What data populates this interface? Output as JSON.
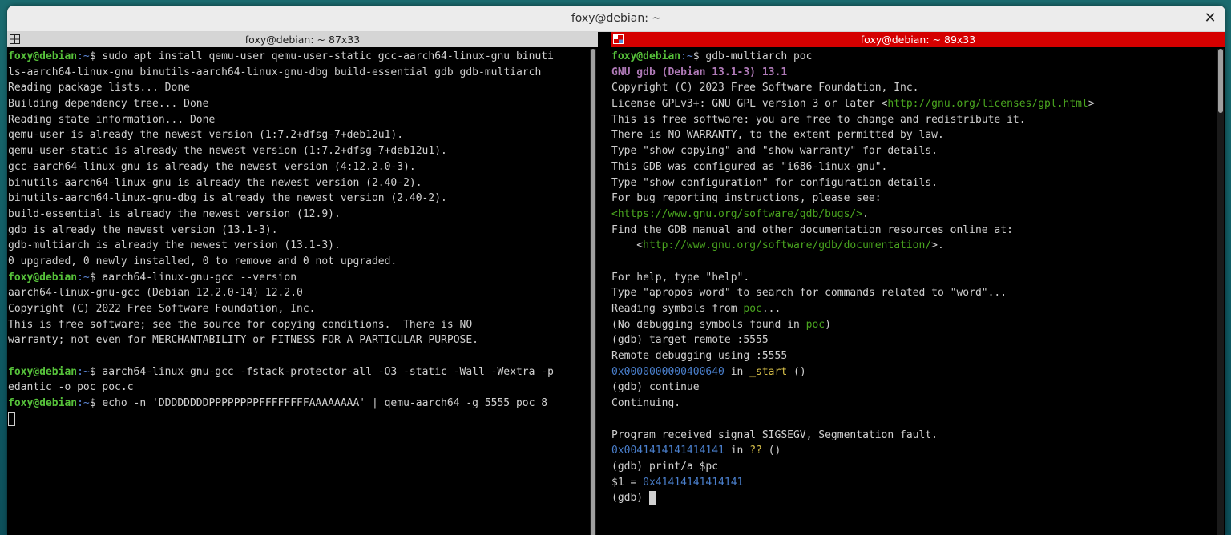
{
  "window": {
    "title": "foxy@debian: ~"
  },
  "left_pane": {
    "title": "foxy@debian: ~ 87x33",
    "lines": [
      [
        {
          "c": "prompt-user",
          "t": "foxy@debian"
        },
        {
          "c": "prompt-path",
          "t": ":~"
        },
        {
          "t": "$ sudo apt install qemu-user qemu-user-static gcc-aarch64-linux-gnu binuti"
        }
      ],
      [
        {
          "t": "ls-aarch64-linux-gnu binutils-aarch64-linux-gnu-dbg build-essential gdb gdb-multiarch"
        }
      ],
      [
        {
          "t": "Reading package lists... Done"
        }
      ],
      [
        {
          "t": "Building dependency tree... Done"
        }
      ],
      [
        {
          "t": "Reading state information... Done"
        }
      ],
      [
        {
          "t": "qemu-user is already the newest version (1:7.2+dfsg-7+deb12u1)."
        }
      ],
      [
        {
          "t": "qemu-user-static is already the newest version (1:7.2+dfsg-7+deb12u1)."
        }
      ],
      [
        {
          "t": "gcc-aarch64-linux-gnu is already the newest version (4:12.2.0-3)."
        }
      ],
      [
        {
          "t": "binutils-aarch64-linux-gnu is already the newest version (2.40-2)."
        }
      ],
      [
        {
          "t": "binutils-aarch64-linux-gnu-dbg is already the newest version (2.40-2)."
        }
      ],
      [
        {
          "t": "build-essential is already the newest version (12.9)."
        }
      ],
      [
        {
          "t": "gdb is already the newest version (13.1-3)."
        }
      ],
      [
        {
          "t": "gdb-multiarch is already the newest version (13.1-3)."
        }
      ],
      [
        {
          "t": "0 upgraded, 0 newly installed, 0 to remove and 0 not upgraded."
        }
      ],
      [
        {
          "c": "prompt-user",
          "t": "foxy@debian"
        },
        {
          "c": "prompt-path",
          "t": ":~"
        },
        {
          "t": "$ aarch64-linux-gnu-gcc --version"
        }
      ],
      [
        {
          "t": "aarch64-linux-gnu-gcc (Debian 12.2.0-14) 12.2.0"
        }
      ],
      [
        {
          "t": "Copyright (C) 2022 Free Software Foundation, Inc."
        }
      ],
      [
        {
          "t": "This is free software; see the source for copying conditions.  There is NO"
        }
      ],
      [
        {
          "t": "warranty; not even for MERCHANTABILITY or FITNESS FOR A PARTICULAR PURPOSE."
        }
      ],
      [
        {
          "t": ""
        }
      ],
      [
        {
          "c": "prompt-user",
          "t": "foxy@debian"
        },
        {
          "c": "prompt-path",
          "t": ":~"
        },
        {
          "t": "$ aarch64-linux-gnu-gcc -fstack-protector-all -O3 -static -Wall -Wextra -p"
        }
      ],
      [
        {
          "t": "edantic -o poc poc.c"
        }
      ],
      [
        {
          "c": "prompt-user",
          "t": "foxy@debian"
        },
        {
          "c": "prompt-path",
          "t": ":~"
        },
        {
          "t": "$ echo -n 'DDDDDDDDPPPPPPPPFFFFFFFFAAAAAAAA' | qemu-aarch64 -g 5555 poc 8"
        }
      ]
    ]
  },
  "right_pane": {
    "title": "foxy@debian: ~ 89x33",
    "lines": [
      [
        {
          "c": "prompt-user",
          "t": "foxy@debian"
        },
        {
          "c": "prompt-path",
          "t": ":~"
        },
        {
          "t": "$ gdb-multiarch poc"
        }
      ],
      [
        {
          "c": "g-title",
          "t": "GNU gdb (Debian 13.1-3) 13.1"
        }
      ],
      [
        {
          "t": "Copyright (C) 2023 Free Software Foundation, Inc."
        }
      ],
      [
        {
          "t": "License GPLv3+: GNU GPL version 3 or later <"
        },
        {
          "c": "url",
          "t": "http://gnu.org/licenses/gpl.html"
        },
        {
          "t": ">"
        }
      ],
      [
        {
          "t": "This is free software: you are free to change and redistribute it."
        }
      ],
      [
        {
          "t": "There is NO WARRANTY, to the extent permitted by law."
        }
      ],
      [
        {
          "t": "Type \"show copying\" and \"show warranty\" for details."
        }
      ],
      [
        {
          "t": "This GDB was configured as \"i686-linux-gnu\"."
        }
      ],
      [
        {
          "t": "Type \"show configuration\" for configuration details."
        }
      ],
      [
        {
          "t": "For bug reporting instructions, please see:"
        }
      ],
      [
        {
          "c": "url",
          "t": "<https://www.gnu.org/software/gdb/bugs/>"
        },
        {
          "t": "."
        }
      ],
      [
        {
          "t": "Find the GDB manual and other documentation resources online at:"
        }
      ],
      [
        {
          "t": "    <"
        },
        {
          "c": "url",
          "t": "http://www.gnu.org/software/gdb/documentation/"
        },
        {
          "t": ">."
        }
      ],
      [
        {
          "t": ""
        }
      ],
      [
        {
          "t": "For help, type \"help\"."
        }
      ],
      [
        {
          "t": "Type \"apropos word\" to search for commands related to \"word\"..."
        }
      ],
      [
        {
          "t": "Reading symbols from "
        },
        {
          "c": "file",
          "t": "poc"
        },
        {
          "t": "..."
        }
      ],
      [
        {
          "t": "(No debugging symbols found in "
        },
        {
          "c": "file",
          "t": "poc"
        },
        {
          "t": ")"
        }
      ],
      [
        {
          "t": "(gdb) target remote :5555"
        }
      ],
      [
        {
          "t": "Remote debugging using :5555"
        }
      ],
      [
        {
          "c": "addr",
          "t": "0x0000000000400640"
        },
        {
          "t": " in "
        },
        {
          "c": "fn",
          "t": "_start"
        },
        {
          "t": " ()"
        }
      ],
      [
        {
          "t": "(gdb) continue"
        }
      ],
      [
        {
          "t": "Continuing."
        }
      ],
      [
        {
          "t": ""
        }
      ],
      [
        {
          "t": "Program received signal SIGSEGV, Segmentation fault."
        }
      ],
      [
        {
          "c": "addr",
          "t": "0x0041414141414141"
        },
        {
          "t": " in "
        },
        {
          "c": "fn",
          "t": "??"
        },
        {
          "t": " ()"
        }
      ],
      [
        {
          "t": "(gdb) print/a $pc"
        }
      ],
      [
        {
          "t": "$1 = "
        },
        {
          "c": "addr",
          "t": "0x41414141414141"
        }
      ],
      [
        {
          "t": "(gdb) "
        }
      ]
    ]
  },
  "icons": {
    "close": "✕",
    "left_pane_icon": "split-pane-icon",
    "right_pane_icon": "split-pane-icon"
  }
}
